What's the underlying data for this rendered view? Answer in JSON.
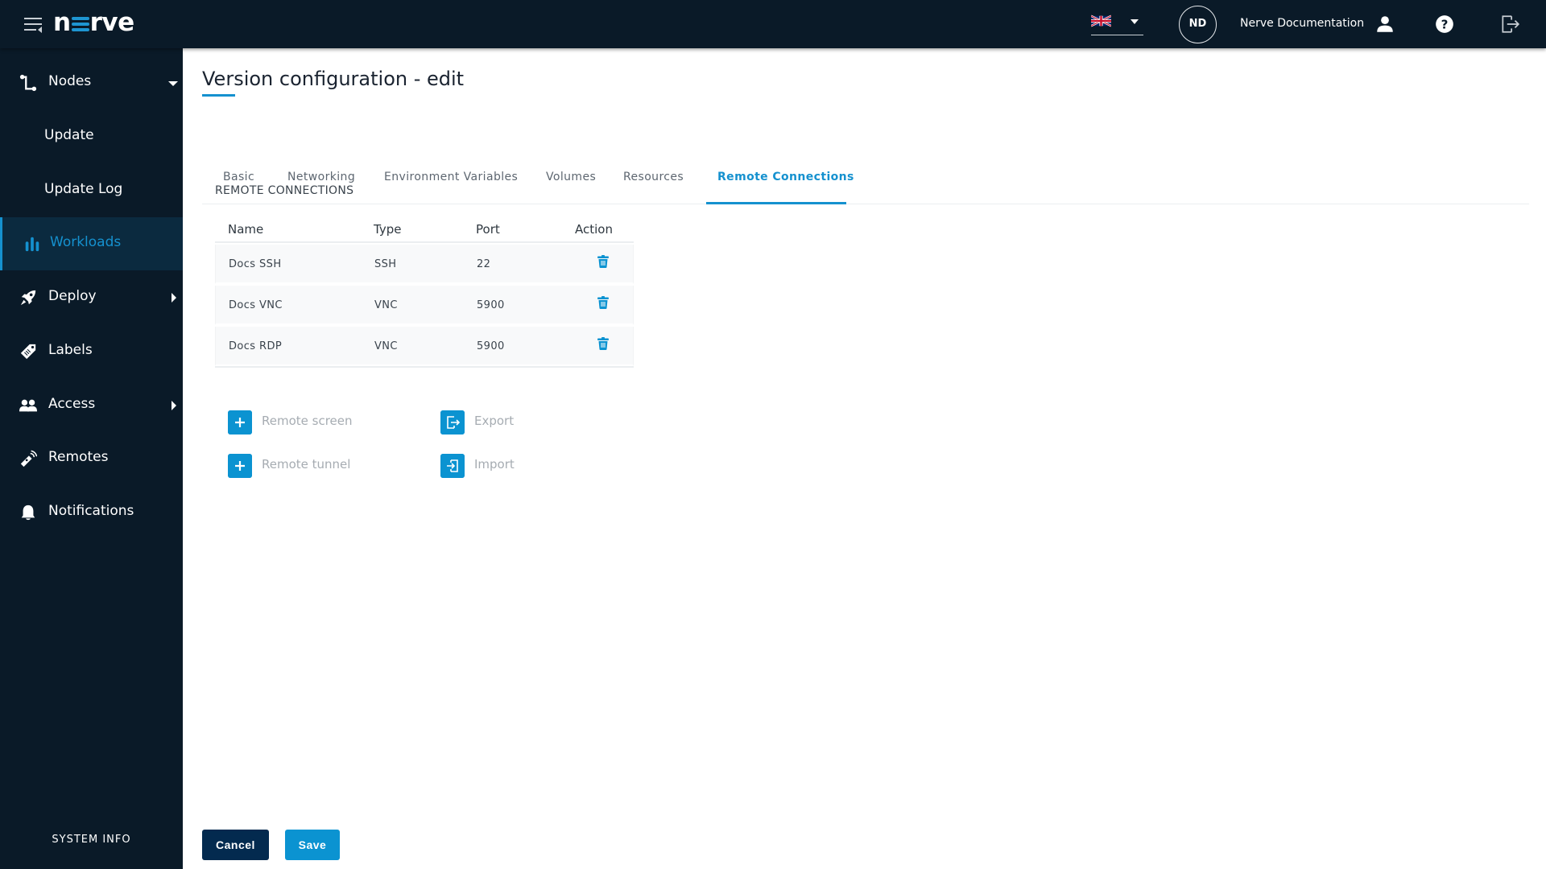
{
  "header": {
    "logo": "nerve",
    "language": "English (UK)",
    "avatar_initials": "ND",
    "user_name": "Nerve Documentation",
    "icons": [
      "menu-icon",
      "uk-flag-icon",
      "user-icon",
      "help-icon",
      "logout-icon"
    ]
  },
  "sidebar": {
    "items": [
      {
        "label": "Nodes",
        "icon": "nodes-icon",
        "expanded": true
      },
      {
        "label": "Update"
      },
      {
        "label": "Update Log"
      },
      {
        "label": "Workloads",
        "icon": "workloads-icon",
        "active": true
      },
      {
        "label": "Deploy",
        "icon": "rocket-icon"
      },
      {
        "label": "Labels",
        "icon": "tag-icon"
      },
      {
        "label": "Access",
        "icon": "users-icon"
      },
      {
        "label": "Remotes",
        "icon": "remote-icon"
      },
      {
        "label": "Notifications",
        "icon": "bell-icon"
      }
    ],
    "footer": "SYSTEM INFO"
  },
  "main": {
    "title": "Version configuration - edit",
    "tabs": [
      {
        "label": "Basic"
      },
      {
        "label": "Networking"
      },
      {
        "label": "Environment Variables"
      },
      {
        "label": "Volumes"
      },
      {
        "label": "Resources"
      },
      {
        "label": "Remote Connections",
        "active": true
      }
    ],
    "section_title": "REMOTE CONNECTIONS",
    "table": {
      "columns": [
        "Name",
        "Type",
        "Port",
        "Action"
      ],
      "rows": [
        {
          "name": "Docs SSH",
          "type": "SSH",
          "port": "22"
        },
        {
          "name": "Docs VNC",
          "type": "VNC",
          "port": "5900"
        },
        {
          "name": "Docs RDP",
          "type": "VNC",
          "port": "5900"
        }
      ]
    },
    "actions": {
      "remote_screen": "Remote screen",
      "remote_tunnel": "Remote tunnel",
      "export": "Export",
      "import": "Import"
    },
    "buttons": {
      "cancel": "Cancel",
      "save": "Save"
    }
  },
  "colors": {
    "accent": "#1591cf",
    "nav_bg": "#0a1a28",
    "cancel_bg": "#032a4f",
    "save_bg": "#0b93d1"
  }
}
